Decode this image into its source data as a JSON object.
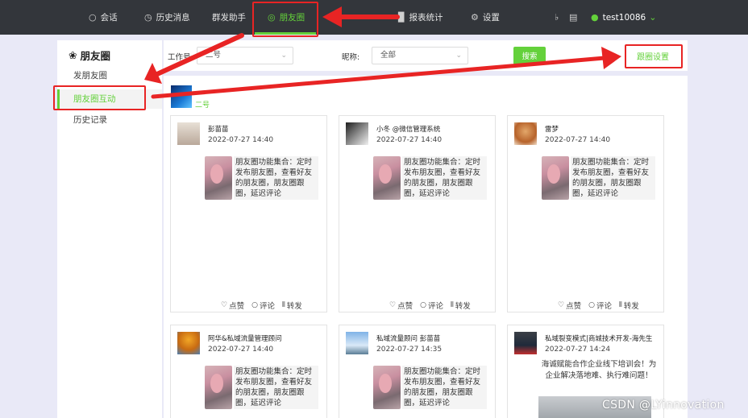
{
  "topnav": {
    "items": [
      {
        "label": "会话",
        "icon": "chat-bubble-icon"
      },
      {
        "label": "历史消息",
        "icon": "clock-icon"
      },
      {
        "label": "群发助手",
        "icon": ""
      },
      {
        "label": "朋友圈",
        "icon": "moments-lens-icon",
        "active": true
      },
      {
        "label": "报表统计",
        "icon": "bar-chart-icon"
      },
      {
        "label": "设置",
        "icon": "gear-icon"
      }
    ],
    "user": "test10086"
  },
  "sidebar": {
    "title": "朋友圈",
    "items": [
      {
        "label": "发朋友圈"
      },
      {
        "label": "朋友圈互动",
        "active": true
      },
      {
        "label": "历史记录"
      }
    ]
  },
  "filter": {
    "workno_label": "工作号:",
    "workno_value": "二号",
    "nickname_label": "昵称:",
    "nickname_value": "全部",
    "search_label": "搜索",
    "setting_label": "跟圈设置"
  },
  "account": {
    "name": "二号"
  },
  "cards": [
    {
      "name": "彭苗苗",
      "time": "2022-07-27 14:40",
      "text": "朋友圈功能集合：定时发布朋友圈，查看好友的朋友圈，朋友圈跟圈，延迟评论"
    },
    {
      "name": "小冬 @微信管理系统",
      "time": "2022-07-27 14:40",
      "text": "朋友圈功能集合：定时发布朋友圈，查看好友的朋友圈，朋友圈跟圈，延迟评论"
    },
    {
      "name": "雷梦",
      "time": "2022-07-27 14:40",
      "text": "朋友圈功能集合：定时发布朋友圈，查看好友的朋友圈，朋友圈跟圈，延迟评论"
    },
    {
      "name": "阿华&私域流量管理顾问",
      "time": "2022-07-27 14:40",
      "text": "朋友圈功能集合：定时发布朋友圈，查看好友的朋友圈，朋友圈跟圈，延迟评论"
    },
    {
      "name": "私域流量顾问 彭苗苗",
      "time": "2022-07-27 14:35",
      "text": "朋友圈功能集合：定时发布朋友圈，查看好友的朋友圈，朋友圈跟圈，延迟评论"
    },
    {
      "name": "私域裂变模式|商城技术开发-海先生",
      "time": "2022-07-27 14:24",
      "text": "海诚赋能合作企业线下培训会！为企业解决落地难、执行难问题！"
    }
  ],
  "actions": {
    "like": "点赞",
    "comment": "评论",
    "share": "转发"
  },
  "watermark": "CSDN @LYinnovation",
  "colors": {
    "accent": "#64d13b",
    "topbar": "#33363b",
    "annotation": "#e82424"
  }
}
